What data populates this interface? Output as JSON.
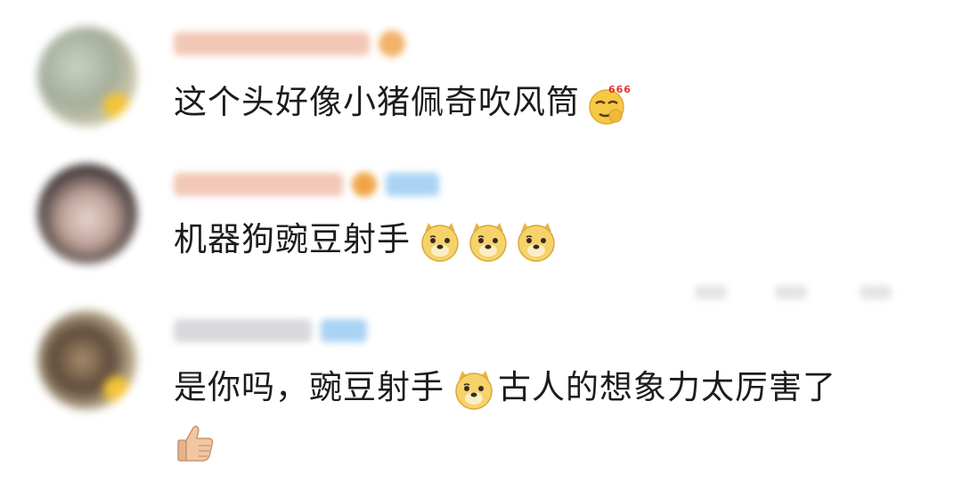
{
  "comments": [
    {
      "text": "这个头好像小猪佩奇吹风筒",
      "emoji": "666-smirk-emoji"
    },
    {
      "text": "机器狗豌豆射手",
      "emoji": "doge-emoji",
      "emoji_count": 3
    },
    {
      "text_before": "是你吗，豌豆射手",
      "emoji": "doge-emoji",
      "text_after": "古人的想象力太厉害了",
      "trailing_emoji": "thumbs-up-emoji"
    }
  ],
  "colors": {
    "text": "#1c1c1c",
    "name_blur": "#f1c9b8",
    "tag_blur": "#9ccdf2",
    "emoji_yellow": "#f6c945"
  }
}
